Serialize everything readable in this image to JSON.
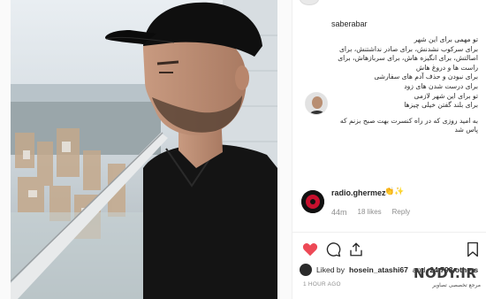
{
  "post": {
    "author_username": "saberabar",
    "caption_lines": [
      "تو مهمی برای این شهر",
      "برای سرکوب نشدنش، برای صادر نداشتنش، برای",
      "اصالتش، برای انگیزه هاش، برای سربازهاش، برای",
      "راست ها و دروغ هاش",
      "برای نبودن و حذف آدم های سفارشی",
      "برای درست شدن های زود",
      "تو برای این شهر لازمی",
      "برای بلند گفتن خیلی چیزها",
      "به امید روزی که در راه کنسرت بهت صبح بزنم که",
      "پاس شد"
    ]
  },
  "comment": {
    "username": "radio.ghermez",
    "emoji": "👏✨",
    "age": "44m",
    "likes_text": "18 likes",
    "reply_label": "Reply"
  },
  "likes": {
    "prefix": "Liked by",
    "user": "hosein_atashi67",
    "middle": "and",
    "count": "24,793 others"
  },
  "timestamp": "1 HOUR AGO",
  "watermark": {
    "brand": "NODY.IR",
    "subtitle": "مرجع تخصصی تصاویر"
  },
  "colors": {
    "like_heart": "#ed4956",
    "secondary_text": "#8e8e8e",
    "primary_text": "#262626"
  },
  "icons": [
    "heart-icon",
    "comment-icon",
    "share-icon",
    "bookmark-icon"
  ]
}
